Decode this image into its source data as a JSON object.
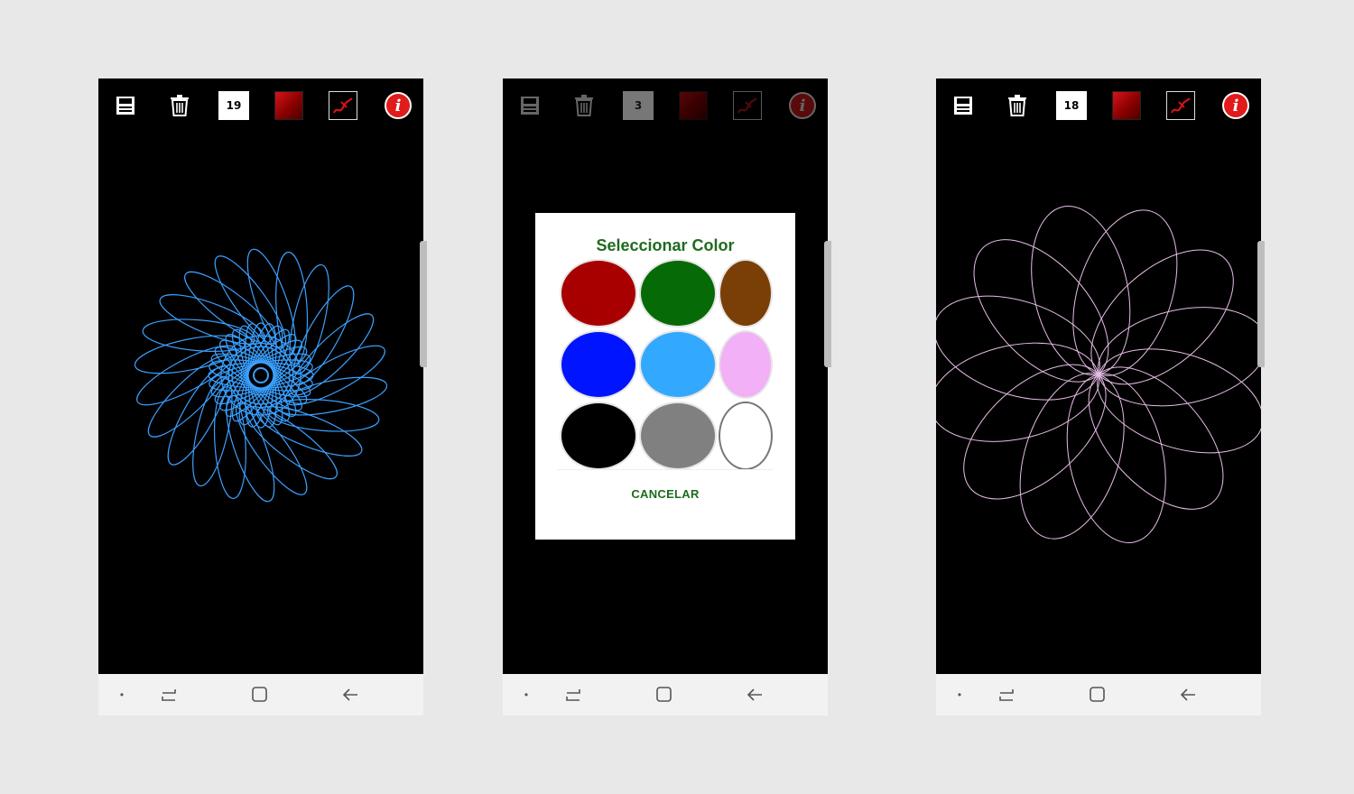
{
  "screens": [
    {
      "brush_size": "19",
      "dimmed": false,
      "drawing": {
        "stroke_color": "#3aa0ff",
        "pattern": "spirograph-blue"
      }
    },
    {
      "brush_size": "3",
      "dimmed": true,
      "dialog": {
        "title": "Seleccionar Color",
        "cancel_label": "CANCELAR",
        "colors": [
          "#a80000",
          "#066b06",
          "#7a3f06",
          "#0014ff",
          "#33a8ff",
          "#f2b0f7",
          "#000000",
          "#808080",
          "#ffffff"
        ]
      }
    },
    {
      "brush_size": "18",
      "dimmed": false,
      "drawing": {
        "stroke_color": "#e6bde6",
        "pattern": "spirograph-pink"
      }
    }
  ],
  "icons": {
    "save": "save-icon",
    "delete": "trash-icon",
    "color": "color-swatch-icon",
    "brush": "brush-icon",
    "info": "info-icon"
  },
  "info_glyph": "i",
  "navbar": {
    "home_dot": "•"
  }
}
